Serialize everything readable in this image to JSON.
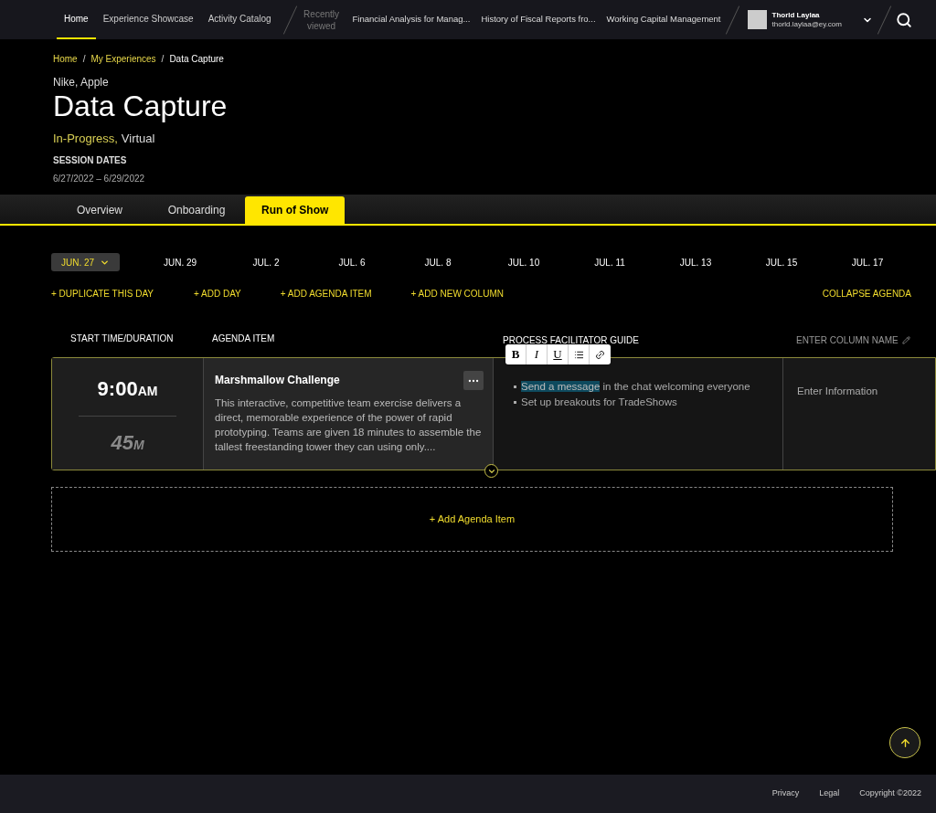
{
  "nav": {
    "items": [
      {
        "label": "Home",
        "selected": true
      },
      {
        "label": "Experience Showcase",
        "selected": false
      },
      {
        "label": "Activity Catalog",
        "selected": false
      }
    ],
    "recent_label": "Recently viewed",
    "recent_items": [
      "Financial Analysis for Manag...",
      "History of Fiscal Reports fro...",
      "Working Capital Management"
    ],
    "user": {
      "name": "Thorld Laylaa",
      "email": "thorld.laylaa@ey.com"
    }
  },
  "breadcrumb": {
    "links": [
      "Home",
      "My Experiences"
    ],
    "separators": [
      "/",
      "/"
    ],
    "current": "Data Capture"
  },
  "header": {
    "clients": "Nike, Apple",
    "title": "Data Capture",
    "status": "In-Progress,",
    "format": "Virtual",
    "dates_label": "SESSION DATES",
    "dates": "6/27/2022 – 6/29/2022"
  },
  "tabs": [
    {
      "label": "Overview",
      "selected": false
    },
    {
      "label": "Onboarding",
      "selected": false
    },
    {
      "label": "Run of Show",
      "selected": true
    }
  ],
  "days": [
    {
      "label": "JUN. 27",
      "selected": true
    },
    {
      "label": "JUN. 29",
      "selected": false
    },
    {
      "label": "JUL. 2",
      "selected": false
    },
    {
      "label": "JUL. 6",
      "selected": false
    },
    {
      "label": "JUL. 8",
      "selected": false
    },
    {
      "label": "JUL. 10",
      "selected": false
    },
    {
      "label": "JUL. 11",
      "selected": false
    },
    {
      "label": "JUL. 13",
      "selected": false
    },
    {
      "label": "JUL. 15",
      "selected": false
    },
    {
      "label": "JUL. 17",
      "selected": false
    }
  ],
  "actions": [
    "+ DUPLICATE THIS DAY",
    "+ ADD DAY",
    "+ ADD AGENDA ITEM",
    "+ ADD NEW COLUMN"
  ],
  "collapse": "COLLAPSE AGENDA",
  "columns": [
    "START TIME/DURATION",
    "AGENDA ITEM",
    "PROCESS FACILITATOR GUIDE"
  ],
  "new_column_placeholder": "ENTER COLUMN NAME",
  "toolbar": [
    "B",
    "I",
    "U"
  ],
  "agenda": [
    {
      "time": "9:00",
      "meridiem": "AM",
      "duration": "45",
      "unit": "M",
      "title": "Marshmallow Challenge",
      "description": "This interactive, competitive team exercise delivers a direct, memorable experience of the power of rapid prototyping. Teams are given 18 minutes to assemble the tallest freestanding tower they can using only....",
      "guide": [
        {
          "selected_text": "Send a message",
          "text": " in the chat welcoming everyone"
        },
        {
          "text": "Set up breakouts for TradeShows"
        }
      ],
      "extra_placeholder": "Enter Information"
    }
  ],
  "add_item": "+ Add Agenda Item",
  "footer": [
    "Privacy",
    "Legal",
    "Copyright ©2022"
  ]
}
